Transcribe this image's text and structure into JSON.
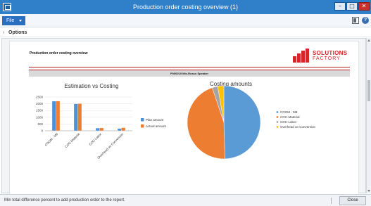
{
  "window": {
    "title": "Production order costing overview (1)",
    "min_label": "–",
    "max_label": "□",
    "close_label": "✕"
  },
  "menu": {
    "file_label": "File",
    "help_label": "?"
  },
  "options": {
    "chevron": "›",
    "label": "Options"
  },
  "report": {
    "title": "Production order costing overview",
    "logo_line1": "SOLUTIONS",
    "logo_line2": "FACTORY",
    "order_band": "P000019 Mix-Rosso Speaker"
  },
  "chart_data": [
    {
      "type": "bar",
      "title": "Estimation vs Costing",
      "categories": [
        "COGM - M9",
        "COC-Material",
        "COC-Labor",
        "Overhead on Conversion"
      ],
      "series": [
        {
          "name": "Plan amount",
          "values": [
            2190,
            2000,
            200,
            160
          ],
          "color": "#4f90d6"
        },
        {
          "name": "Actual amount",
          "values": [
            2200,
            2010,
            210,
            230
          ],
          "color": "#ed7d31"
        }
      ],
      "ylim": [
        0,
        2500
      ],
      "yticks": [
        0,
        500,
        1000,
        1500,
        2000,
        2500
      ],
      "legend": "right",
      "grid": true
    },
    {
      "type": "pie",
      "title": "Costing amounts",
      "labels": [
        "COGM - M9",
        "COC-Material",
        "COC-Labor",
        "Overhead on Conversion"
      ],
      "values": [
        2200,
        2010,
        110,
        120
      ],
      "colors": [
        "#5b9bd5",
        "#ed7d31",
        "#a5a5a5",
        "#ffc000"
      ],
      "legend": "right"
    }
  ],
  "status": {
    "message": "Min total difference percent to add production order to the report.",
    "close_label": "Close"
  }
}
